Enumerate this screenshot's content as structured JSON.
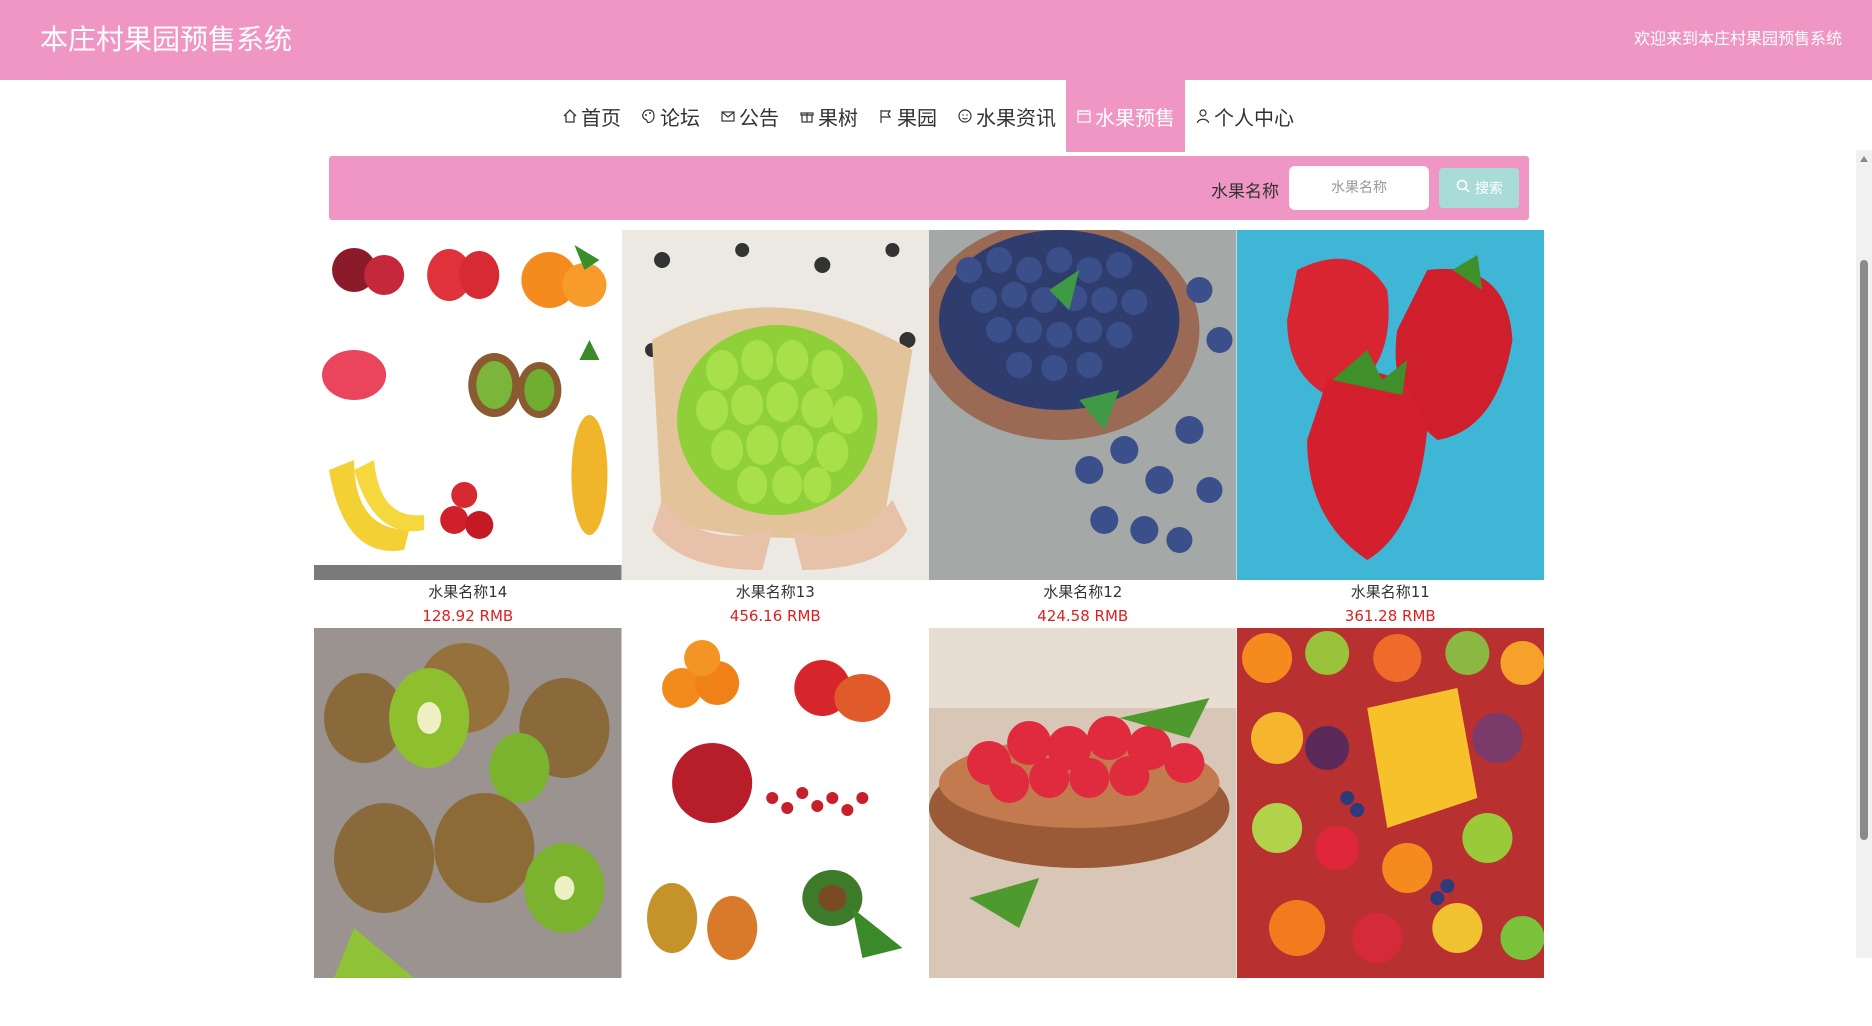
{
  "header": {
    "site_title": "本庄村果园预售系统",
    "welcome": "欢迎来到本庄村果园预售系统",
    "bg_color": "#f096c5"
  },
  "nav": {
    "items": [
      {
        "label": "首页",
        "icon": "home-icon"
      },
      {
        "label": "论坛",
        "icon": "palette-icon"
      },
      {
        "label": "公告",
        "icon": "mail-icon"
      },
      {
        "label": "果树",
        "icon": "gift-icon"
      },
      {
        "label": "果园",
        "icon": "flag-icon"
      },
      {
        "label": "水果资讯",
        "icon": "smile-icon"
      },
      {
        "label": "水果预售",
        "icon": "calendar-icon",
        "active": true
      },
      {
        "label": "个人中心",
        "icon": "user-icon"
      }
    ]
  },
  "search": {
    "label": "水果名称",
    "placeholder": "水果名称",
    "button_label": "搜索"
  },
  "products": [
    {
      "name": "水果名称14",
      "price": "128.92 RMB",
      "image": "mixed-fruits-collage"
    },
    {
      "name": "水果名称13",
      "price": "456.16 RMB",
      "image": "green-grapes"
    },
    {
      "name": "水果名称12",
      "price": "424.58 RMB",
      "image": "blueberries"
    },
    {
      "name": "水果名称11",
      "price": "361.28 RMB",
      "image": "strawberries"
    },
    {
      "name": "",
      "price": "",
      "image": "kiwis"
    },
    {
      "name": "",
      "price": "",
      "image": "oranges-pomegranate-pears"
    },
    {
      "name": "",
      "price": "",
      "image": "raspberries-bowl"
    },
    {
      "name": "",
      "price": "",
      "image": "fruit-platter"
    }
  ],
  "colors": {
    "accent": "#f096c5",
    "price": "#e02020",
    "search_button": "#a9dcd9"
  }
}
